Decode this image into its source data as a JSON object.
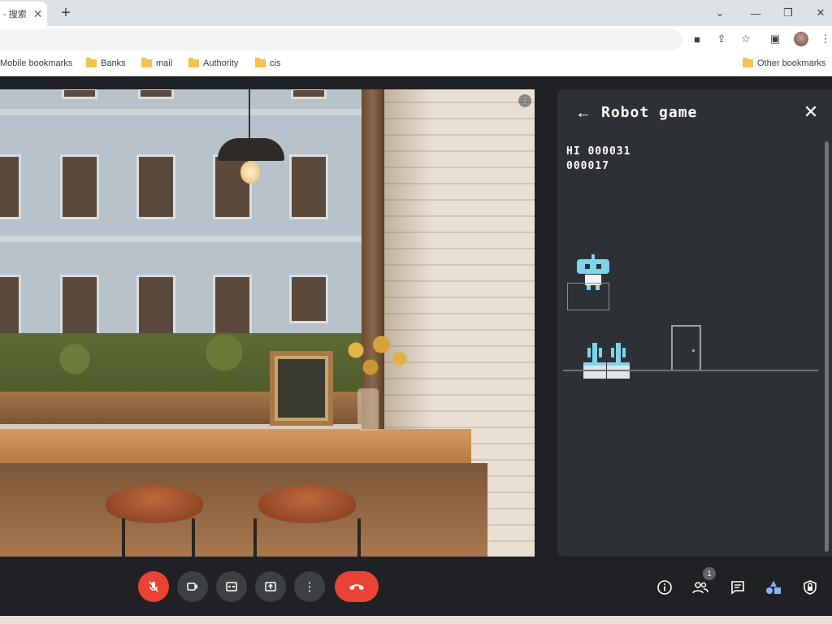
{
  "browser": {
    "tab_title": "- 搜索",
    "bookmarks": [
      "Mobile bookmarks",
      "Banks",
      "mail",
      "Authority",
      "cis"
    ],
    "other_bookmarks": "Other bookmarks"
  },
  "panel": {
    "title": "Robot game",
    "hi_score": "HI 000031",
    "score": "000017"
  },
  "controls": {
    "participant_count": "1"
  },
  "colors": {
    "end_call": "#ea4335",
    "panel_bg": "#2d3035",
    "robot": "#7fd4ea"
  },
  "icons": [
    "mic-off-icon",
    "camera-icon",
    "captions-icon",
    "present-icon",
    "more-icon",
    "end-call-icon",
    "info-icon",
    "people-icon",
    "chat-icon",
    "activities-icon",
    "host-controls-icon"
  ]
}
